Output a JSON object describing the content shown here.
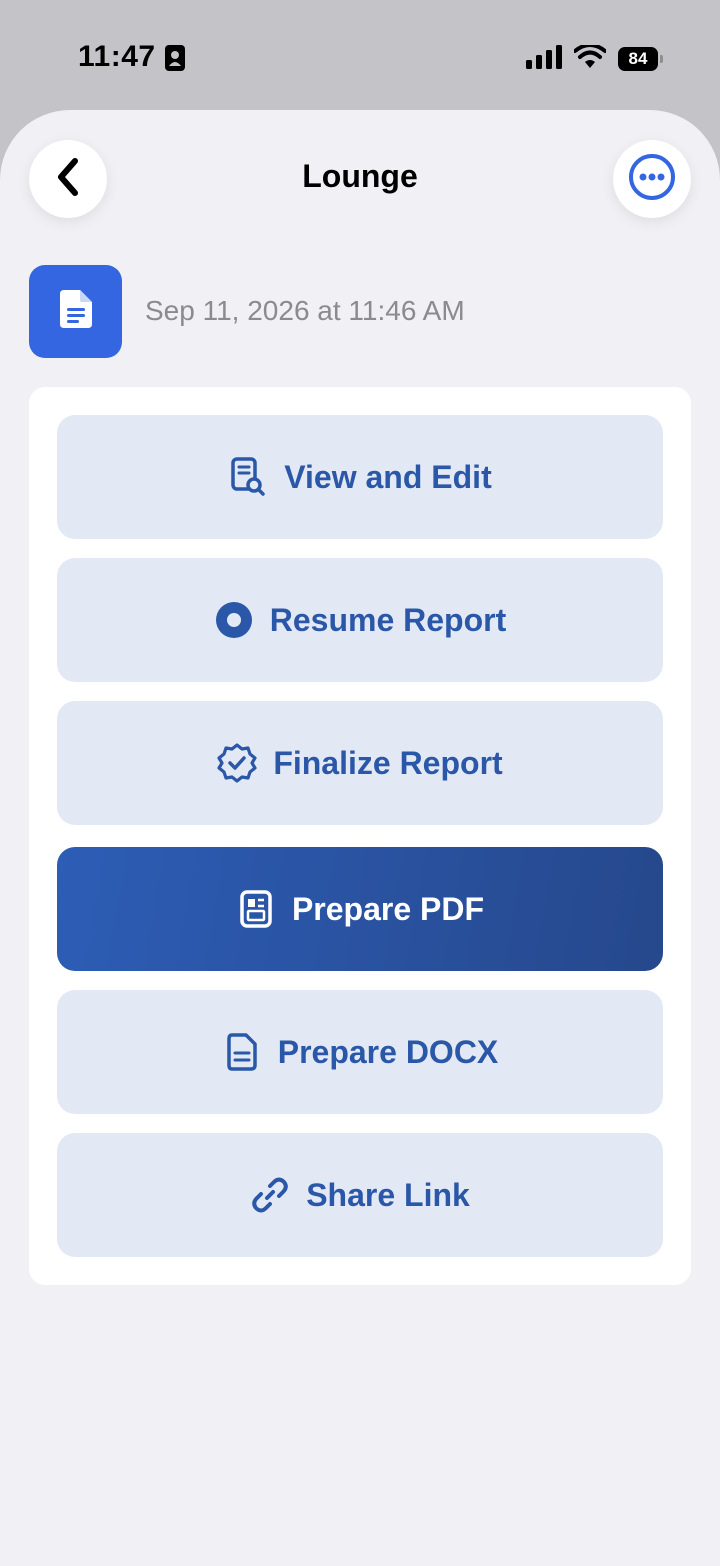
{
  "status_bar": {
    "time": "11:47",
    "battery": "84"
  },
  "header": {
    "title": "Lounge"
  },
  "document": {
    "date": "Sep 11, 2026 at 11:46 AM"
  },
  "actions": [
    {
      "label": "View and Edit",
      "icon": "document-search-icon"
    },
    {
      "label": "Resume Report",
      "icon": "record-circle-icon"
    },
    {
      "label": "Finalize Report",
      "icon": "verified-badge-icon"
    },
    {
      "label": "Prepare PDF",
      "icon": "pdf-document-icon"
    },
    {
      "label": "Prepare DOCX",
      "icon": "docx-document-icon"
    },
    {
      "label": "Share Link",
      "icon": "link-icon"
    }
  ],
  "colors": {
    "accent": "#3366e0",
    "button_text": "#2a57a8",
    "button_bg": "#e3e9f4",
    "primary_bg": "#2d5db6"
  }
}
